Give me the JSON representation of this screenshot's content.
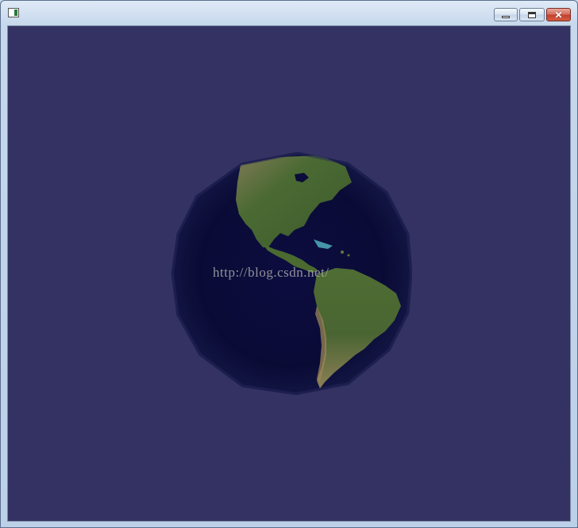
{
  "window": {
    "title": "",
    "controls": {
      "minimize": "minimize",
      "maximize": "maximize",
      "close": "close"
    }
  },
  "canvas": {
    "background_color": "#343263",
    "globe": {
      "ocean_color": "#0b0c3a",
      "land_color": "#3f5a2a",
      "desert_color": "#9a8657"
    },
    "watermark": "http://blog.csdn.net/"
  }
}
